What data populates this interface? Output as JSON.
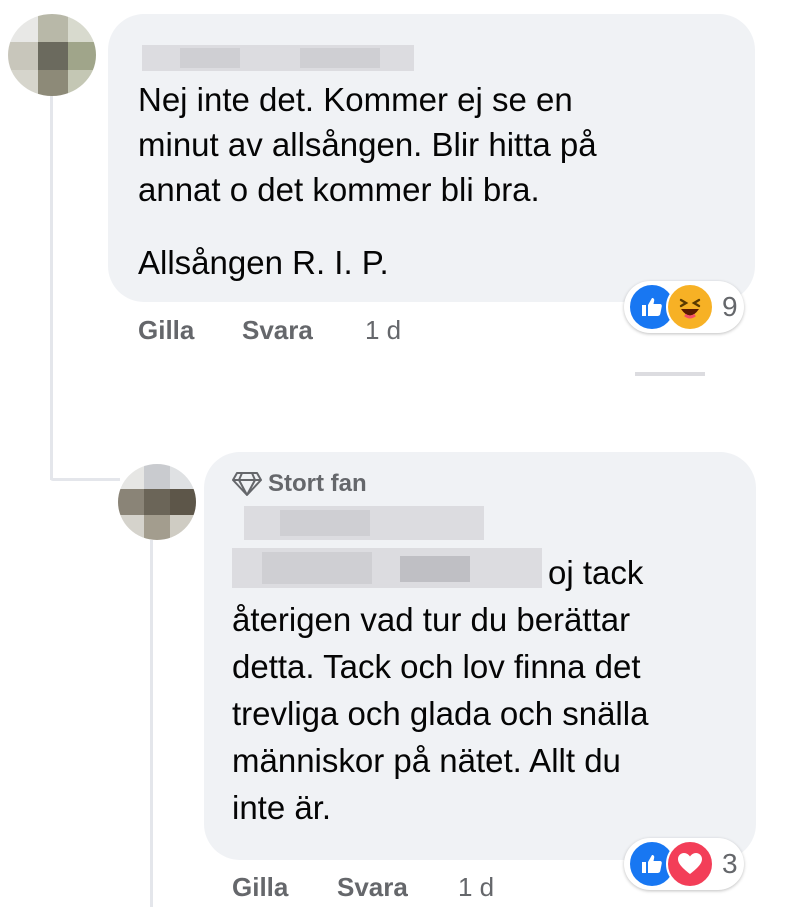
{
  "colors": {
    "like_blue": "#1877f2",
    "haha_yellow": "#f7b125",
    "love_red": "#f33e58",
    "meta_gray": "#65676b",
    "bubble_bg": "#f0f2f5"
  },
  "comment1": {
    "lines": [
      "Nej inte det. Kommer ej se en",
      "minut av allsången. Blir hitta på",
      "annat o det kommer bli bra."
    ],
    "line2": "Allsången R. I. P.",
    "actions": {
      "like": "Gilla",
      "reply": "Svara",
      "time": "1 d"
    },
    "reactions": {
      "icons": [
        "like-icon",
        "haha-icon"
      ],
      "count": "9"
    }
  },
  "reply1": {
    "badge": {
      "icon": "diamond-icon",
      "label": "Stort fan"
    },
    "first_line_tail": "oj tack",
    "lines": [
      "återigen vad tur du berättar",
      "detta. Tack och lov finna det",
      "trevliga och glada och snälla",
      "människor på nätet. Allt du",
      "inte är."
    ],
    "actions": {
      "like": "Gilla",
      "reply": "Svara",
      "time": "1 d"
    },
    "reactions": {
      "icons": [
        "like-icon",
        "love-icon"
      ],
      "count": "3"
    }
  }
}
